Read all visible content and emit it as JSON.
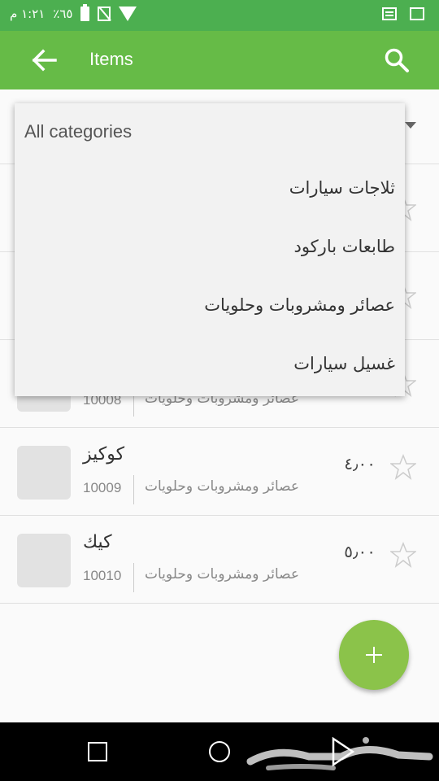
{
  "status_bar": {
    "time": "١:٢١ م",
    "battery": "٪٦٥"
  },
  "app_bar": {
    "title": "Items"
  },
  "dropdown": {
    "header": "All categories",
    "options": [
      "ثلاجات سيارات",
      "طابعات باركود",
      "عصائر ومشروبات وحلويات",
      "غسيل سيارات"
    ]
  },
  "items": [
    {
      "name": "",
      "code": "10008",
      "category": "عصائر ومشروبات وحلويات",
      "price": ""
    },
    {
      "name": "كوكيز",
      "code": "10009",
      "category": "عصائر ومشروبات وحلويات",
      "price": "٤٫٠٠"
    },
    {
      "name": "كيك",
      "code": "10010",
      "category": "عصائر ومشروبات وحلويات",
      "price": "٥٫٠٠"
    }
  ],
  "icons": {
    "back": "arrow-left-icon",
    "search": "search-icon",
    "star": "star-outline-icon",
    "fab": "plus-icon",
    "nav_recent": "square-icon",
    "nav_home": "circle-icon",
    "nav_back": "triangle-back-icon"
  },
  "colors": {
    "status_bar": "#4caf50",
    "app_bar": "#66bb47",
    "fab": "#8bc34a"
  }
}
